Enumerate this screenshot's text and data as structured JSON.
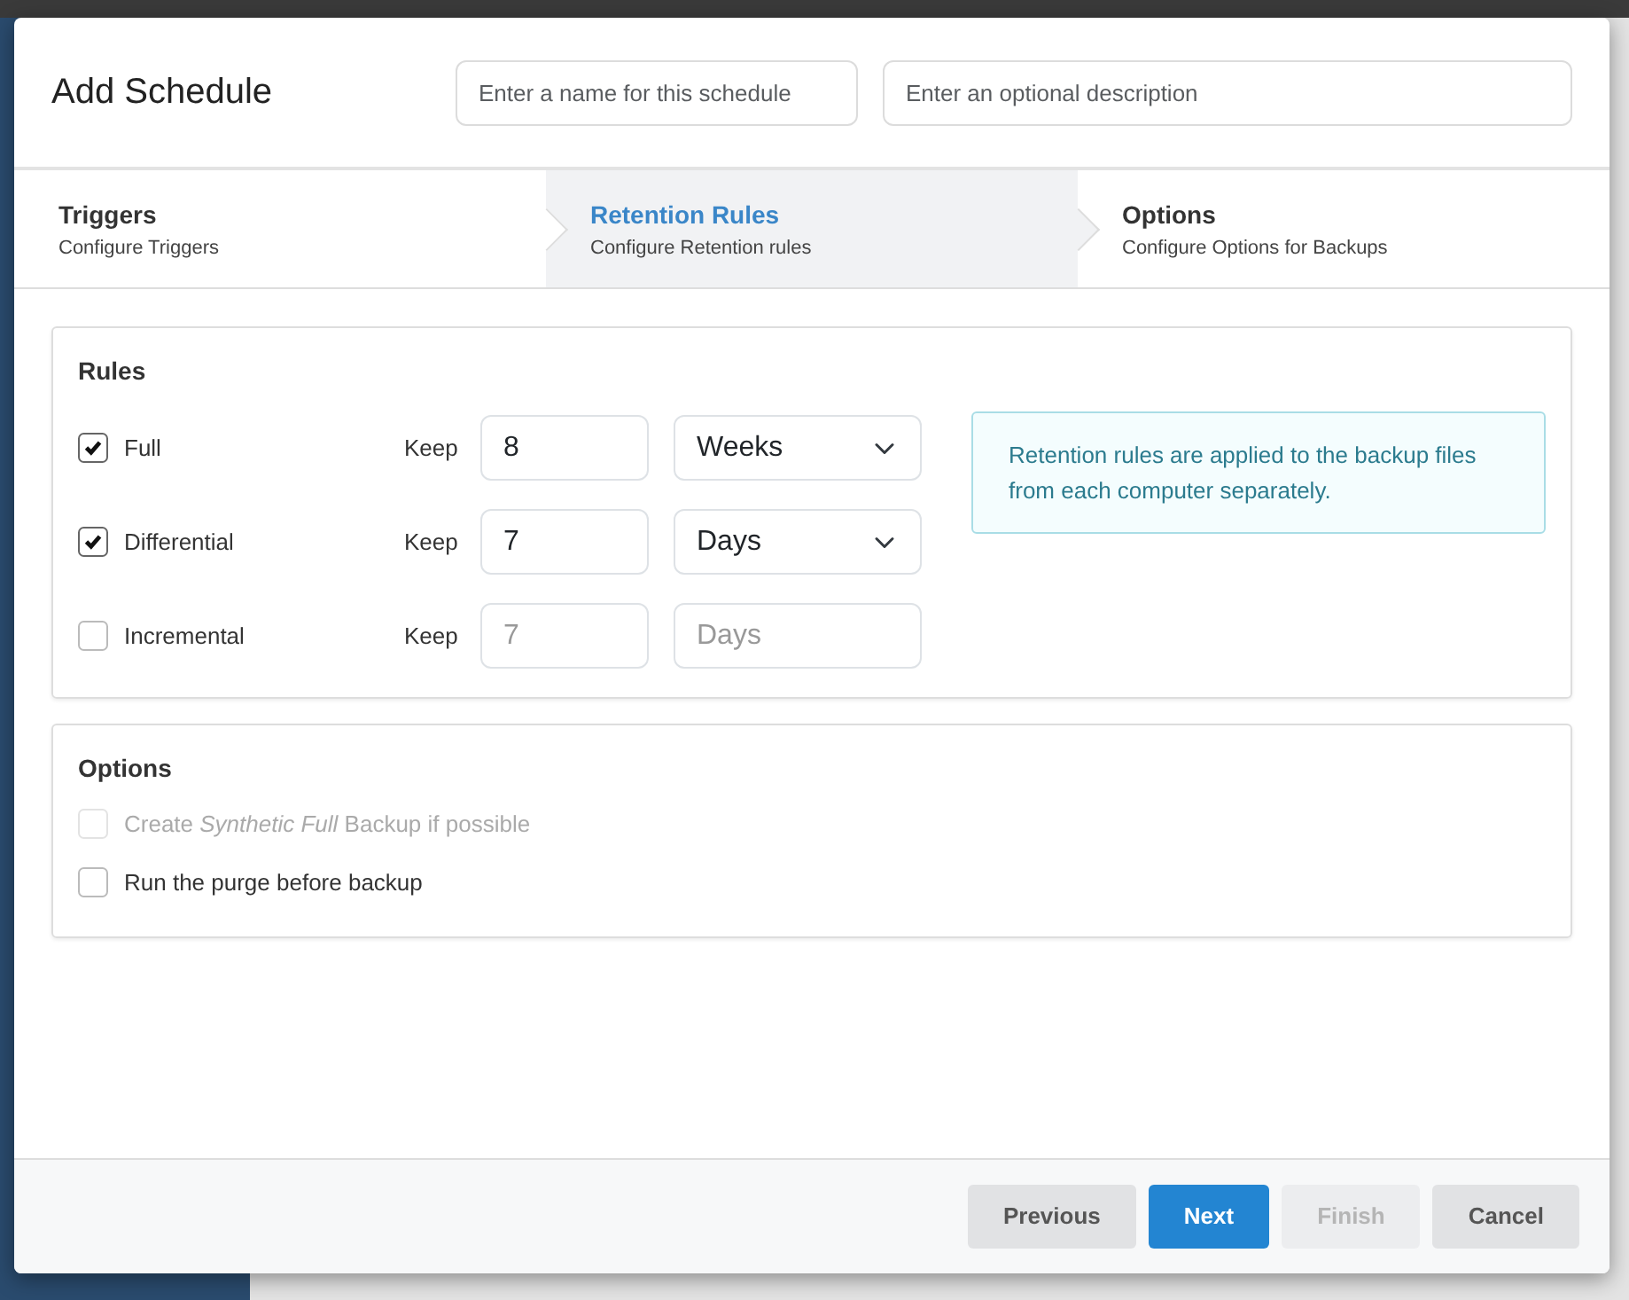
{
  "window": {
    "title": "Add Schedule"
  },
  "header_fields": [
    {
      "placeholder": "Enter a name for this schedule"
    },
    {
      "placeholder": "Enter an optional description"
    }
  ],
  "steps": [
    {
      "title": "Triggers",
      "subtitle": "Configure Triggers",
      "selected": false
    },
    {
      "title": "Retention Rules",
      "subtitle": "Configure Retention rules",
      "selected": true
    },
    {
      "title": "Options",
      "subtitle": "Configure Options for Backups",
      "selected": false
    }
  ],
  "rules": {
    "title": "Rules",
    "rows": [
      {
        "label": "Full",
        "checked": true,
        "keep_label": "Keep",
        "value": "8",
        "unit": "Weeks",
        "disabled": false
      },
      {
        "label": "Differential",
        "checked": true,
        "keep_label": "Keep",
        "value": "7",
        "unit": "Days",
        "disabled": false
      },
      {
        "label": "Incremental",
        "checked": false,
        "keep_label": "Keep",
        "value": "7",
        "unit": "Days",
        "disabled": true
      }
    ],
    "info": "Retention rules are applied to the backup files from each computer separately."
  },
  "options": {
    "title": "Options",
    "items": [
      {
        "label": "Create *Synthetic Full* Backup if possible",
        "checked": false,
        "disabled": true
      },
      {
        "label": "Run the purge before backup",
        "checked": false,
        "disabled": false
      }
    ]
  },
  "buttons": [
    {
      "label": "Previous",
      "kind": "secondary",
      "disabled": false
    },
    {
      "label": "Next",
      "kind": "primary",
      "disabled": false
    },
    {
      "label": "Finish",
      "kind": "secondary",
      "disabled": true
    },
    {
      "label": "Cancel",
      "kind": "secondary",
      "disabled": false
    }
  ]
}
